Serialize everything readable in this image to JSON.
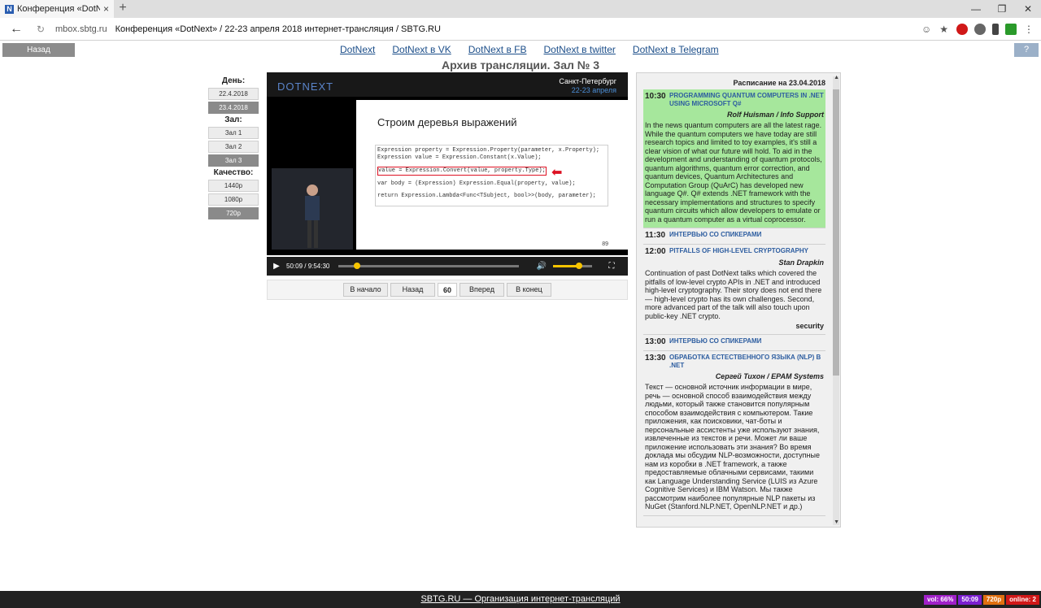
{
  "browser": {
    "tab_title": "Конференция «DotNext»",
    "favicon_letter": "N",
    "url_host": "mbox.sbtg.ru",
    "page_title": "Конференция «DotNext» / 22-23 апреля 2018 интернет-трансляция / SBTG.RU"
  },
  "topnav": {
    "back_label": "Назад",
    "help_label": "?",
    "links": [
      "DotNext",
      "DotNext в VK",
      "DotNext в FB",
      "DotNext в twitter",
      "DotNext в Telegram"
    ]
  },
  "heading": "Архив трансляции. Зал № 3",
  "controls": {
    "day_label": "День:",
    "days": [
      {
        "label": "22.4.2018",
        "active": false
      },
      {
        "label": "23.4.2018",
        "active": true
      }
    ],
    "hall_label": "Зал:",
    "halls": [
      {
        "label": "Зал 1",
        "active": false
      },
      {
        "label": "Зал 2",
        "active": false
      },
      {
        "label": "Зал 3",
        "active": true
      }
    ],
    "quality_label": "Качество:",
    "qualities": [
      {
        "label": "1440p",
        "active": false
      },
      {
        "label": "1080p",
        "active": false
      },
      {
        "label": "720p",
        "active": true
      }
    ]
  },
  "video": {
    "logo": "DOTNEXT",
    "city": "Санкт-Петербург",
    "dates": "22-23 апреля",
    "slide_title": "Строим деревья выражений",
    "slide_page": "89",
    "code_lines": [
      "Expression property = Expression.Property(parameter, x.Property);",
      "Expression value = Expression.Constant(x.Value);",
      "value = Expression.Convert(value, property.Type);",
      "var body = (Expression) Expression.Equal(property, value);",
      "return Expression.Lambda<Func<TSubject, bool>>(body, parameter);"
    ],
    "time": "50:09 / 9:54:30",
    "progress_fraction": 0.084,
    "volume_fraction": 0.66
  },
  "nav_buttons": {
    "start": "В начало",
    "back": "Назад",
    "step": "60",
    "forward": "Вперед",
    "end": "В конец"
  },
  "schedule": {
    "title": "Расписание на 23.04.2018",
    "items": [
      {
        "time": "10:30",
        "title": "PROGRAMMING QUANTUM COMPUTERS IN .NET USING MICROSOFT Q#",
        "speaker": "Rolf Huisman / Info Support",
        "desc": "In the news quantum computers are all the latest rage. While the quantum computers we have today are still research topics and limited to toy examples, it's still a clear vision of what our future will hold. To aid in the development and understanding of quantum protocols, quantum algorithms, quantum error correction, and quantum devices, Quantum Architectures and Computation Group (QuArC) has developed new language Q#. Q# extends .NET framework with the necessary implementations and structures to specify quantum circuits which allow developers to emulate or run a quantum computer as a virtual coprocessor.",
        "tag": "",
        "active": true
      },
      {
        "time": "11:30",
        "title": "ИНТЕРВЬЮ СО СПИКЕРАМИ",
        "speaker": "",
        "desc": "",
        "tag": "",
        "active": false
      },
      {
        "time": "12:00",
        "title": "PITFALLS OF HIGH-LEVEL CRYPTOGRAPHY",
        "speaker": "Stan Drapkin",
        "desc": "Continuation of past DotNext talks which covered the pitfalls of low-level crypto APIs in .NET and introduced high-level cryptography. Their story does not end there — high-level crypto has its own challenges. Second, more advanced part of the talk will also touch upon public-key .NET crypto.",
        "tag": "security",
        "active": false
      },
      {
        "time": "13:00",
        "title": "ИНТЕРВЬЮ СО СПИКЕРАМИ",
        "speaker": "",
        "desc": "",
        "tag": "",
        "active": false
      },
      {
        "time": "13:30",
        "title": "ОБРАБОТКА ЕСТЕСТВЕННОГО ЯЗЫКА (NLP) В .NET",
        "speaker": "Сергей Тихон / EPAM Systems",
        "desc": "Текст — основной источник информации в мире, речь — основной способ взаимодействия между людьми, который также становится популярным способом взаимодействия с компьютером. Такие приложения, как поисковики, чат-боты и персональные ассистенты уже используют знания, извлеченные из текстов и речи. Может ли ваше приложение использовать эти знания? Во время доклада мы обсудим NLP-возможности, доступные нам из коробки в .NET framework, а также предоставляемые облачными сервисами, такими как Language Understanding Service (LUIS из Azure Cognitive Services) и IBM Watson. Мы также рассмотрим наиболее популярные NLP пакеты из NuGet (Stanford.NLP.NET, OpenNLP.NET и др.)",
        "tag": "",
        "active": false
      }
    ]
  },
  "footer": {
    "text": "SBTG.RU — Организация интернет-трансляций",
    "badges": [
      {
        "label": "vol: 66%",
        "color": "#a020c8"
      },
      {
        "label": "50:09",
        "color": "#7b1fd0"
      },
      {
        "label": "720p",
        "color": "#e07010"
      },
      {
        "label": "online: 2",
        "color": "#d01818"
      }
    ]
  }
}
